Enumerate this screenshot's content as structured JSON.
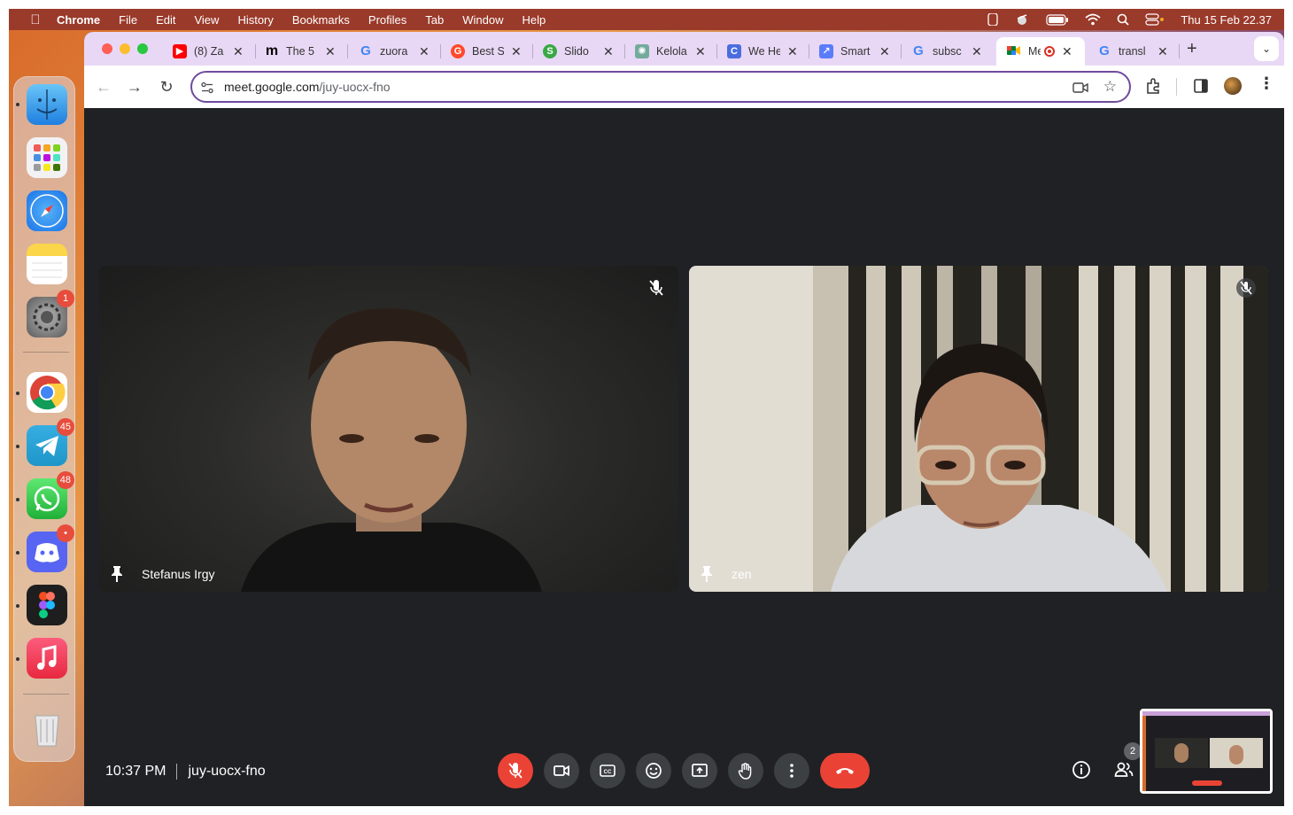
{
  "menubar": {
    "app_name": "Chrome",
    "menus": [
      "File",
      "Edit",
      "View",
      "History",
      "Bookmarks",
      "Profiles",
      "Tab",
      "Window",
      "Help"
    ],
    "clock": "Thu 15 Feb  22.37"
  },
  "dock": {
    "badges": {
      "settings": "1",
      "telegram": "45",
      "whatsapp": "48",
      "discord": "•"
    }
  },
  "tabs": [
    {
      "title": "(8) Za",
      "icon": "youtube-icon",
      "color": "#ff0000"
    },
    {
      "title": "The 5",
      "icon": "medium-icon",
      "color": "#000000"
    },
    {
      "title": "zuora",
      "icon": "google-icon",
      "color": "#4285f4"
    },
    {
      "title": "Best S",
      "icon": "g2-icon",
      "color": "#ff492c"
    },
    {
      "title": "Slido",
      "icon": "slido-icon",
      "color": "#3aa845"
    },
    {
      "title": "Kelola",
      "icon": "openai-icon",
      "color": "#74aa9c"
    },
    {
      "title": "We He",
      "icon": "site-icon",
      "color": "#4a6ee0"
    },
    {
      "title": "Smart",
      "icon": "chart-icon",
      "color": "#5b7cfa"
    },
    {
      "title": "subsc",
      "icon": "google-icon",
      "color": "#4285f4"
    },
    {
      "title": "Me",
      "icon": "meet-icon",
      "color": "#00832d",
      "active": true
    },
    {
      "title": "transl",
      "icon": "google-icon",
      "color": "#4285f4"
    }
  ],
  "address": {
    "domain": "meet.google.com",
    "path": "/juy-uocx-fno"
  },
  "meet": {
    "participants": [
      {
        "name": "Stefanus Irgy"
      },
      {
        "name": "zen"
      }
    ],
    "time": "10:37 PM",
    "meeting_code": "juy-uocx-fno",
    "participant_count": "2"
  },
  "colors": {
    "accent": "#6f4b9c",
    "end_call": "#ea4335",
    "bg": "#202124"
  }
}
